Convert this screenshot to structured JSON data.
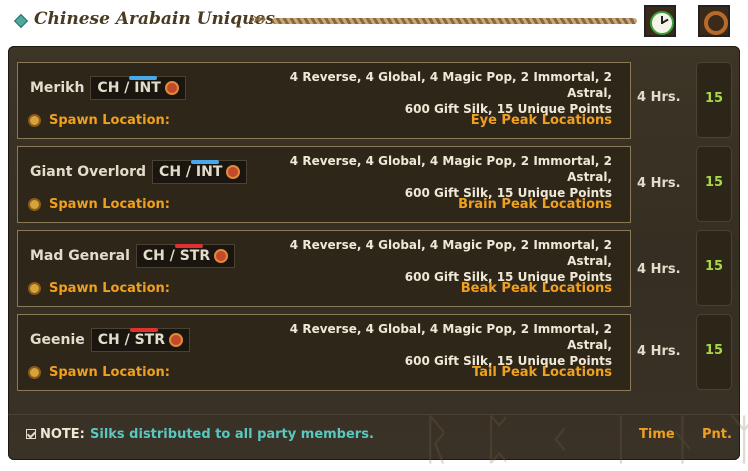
{
  "header": {
    "title": "Chinese Arabain Uniques",
    "chevrons": "»»",
    "icons": [
      "clock-icon",
      "ring-icon"
    ]
  },
  "uniques": [
    {
      "name": "Merikh",
      "region": "CH / INT",
      "tag_bar_color": "#4aa8e8",
      "rewards_line1": "4 Reverse, 4 Global, 4 Magic Pop, 2 Immortal, 2 Astral,",
      "rewards_line2": "600 Gift Silk, 15 Unique Points",
      "spawn_label": "Spawn Location:",
      "location": "Eye Peak Locations",
      "time": "4 Hrs.",
      "points": "15"
    },
    {
      "name": "Giant Overlord",
      "region": "CH / INT",
      "tag_bar_color": "#4aa8e8",
      "rewards_line1": "4 Reverse, 4 Global, 4 Magic Pop, 2 Immortal, 2 Astral,",
      "rewards_line2": "600 Gift Silk, 15 Unique Points",
      "spawn_label": "Spawn Location:",
      "location": "Brain Peak Locations",
      "time": "4 Hrs.",
      "points": "15"
    },
    {
      "name": "Mad General",
      "region": "CH / STR",
      "tag_bar_color": "#e03030",
      "rewards_line1": "4 Reverse, 4 Global, 4 Magic Pop, 2 Immortal, 2 Astral,",
      "rewards_line2": "600 Gift Silk, 15 Unique Points",
      "spawn_label": "Spawn Location:",
      "location": "Beak Peak Locations",
      "time": "4 Hrs.",
      "points": "15"
    },
    {
      "name": "Geenie",
      "region": "CH / STR",
      "tag_bar_color": "#e03030",
      "rewards_line1": "4 Reverse, 4 Global, 4 Magic Pop, 2 Immortal, 2 Astral,",
      "rewards_line2": "600 Gift Silk, 15 Unique Points",
      "spawn_label": "Spawn Location:",
      "location": "Tail Peak Locations",
      "time": "4 Hrs.",
      "points": "15"
    }
  ],
  "footer": {
    "note_label": "NOTE:",
    "note_text": "Silks distributed to all party members.",
    "time_header": "Time",
    "points_header": "Pnt."
  },
  "colors": {
    "accent_orange": "#f0a020",
    "note_teal": "#58c8c0",
    "points_green": "#a8d848"
  }
}
